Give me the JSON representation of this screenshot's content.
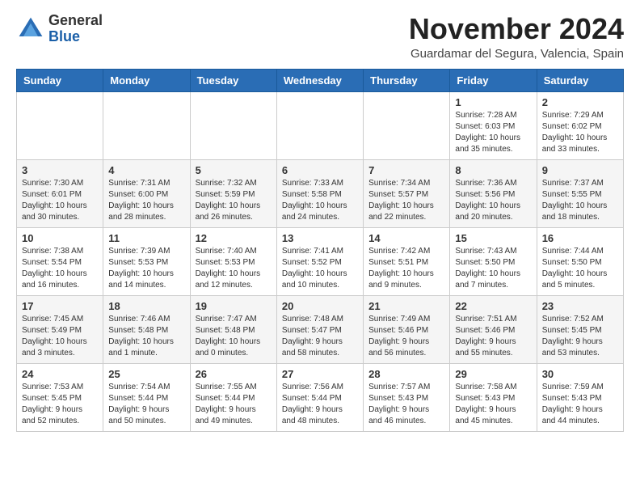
{
  "header": {
    "logo": {
      "general": "General",
      "blue": "Blue"
    },
    "title": "November 2024",
    "location": "Guardamar del Segura, Valencia, Spain"
  },
  "calendar": {
    "days_of_week": [
      "Sunday",
      "Monday",
      "Tuesday",
      "Wednesday",
      "Thursday",
      "Friday",
      "Saturday"
    ],
    "weeks": [
      [
        {
          "day": "",
          "info": ""
        },
        {
          "day": "",
          "info": ""
        },
        {
          "day": "",
          "info": ""
        },
        {
          "day": "",
          "info": ""
        },
        {
          "day": "",
          "info": ""
        },
        {
          "day": "1",
          "info": "Sunrise: 7:28 AM\nSunset: 6:03 PM\nDaylight: 10 hours and 35 minutes."
        },
        {
          "day": "2",
          "info": "Sunrise: 7:29 AM\nSunset: 6:02 PM\nDaylight: 10 hours and 33 minutes."
        }
      ],
      [
        {
          "day": "3",
          "info": "Sunrise: 7:30 AM\nSunset: 6:01 PM\nDaylight: 10 hours and 30 minutes."
        },
        {
          "day": "4",
          "info": "Sunrise: 7:31 AM\nSunset: 6:00 PM\nDaylight: 10 hours and 28 minutes."
        },
        {
          "day": "5",
          "info": "Sunrise: 7:32 AM\nSunset: 5:59 PM\nDaylight: 10 hours and 26 minutes."
        },
        {
          "day": "6",
          "info": "Sunrise: 7:33 AM\nSunset: 5:58 PM\nDaylight: 10 hours and 24 minutes."
        },
        {
          "day": "7",
          "info": "Sunrise: 7:34 AM\nSunset: 5:57 PM\nDaylight: 10 hours and 22 minutes."
        },
        {
          "day": "8",
          "info": "Sunrise: 7:36 AM\nSunset: 5:56 PM\nDaylight: 10 hours and 20 minutes."
        },
        {
          "day": "9",
          "info": "Sunrise: 7:37 AM\nSunset: 5:55 PM\nDaylight: 10 hours and 18 minutes."
        }
      ],
      [
        {
          "day": "10",
          "info": "Sunrise: 7:38 AM\nSunset: 5:54 PM\nDaylight: 10 hours and 16 minutes."
        },
        {
          "day": "11",
          "info": "Sunrise: 7:39 AM\nSunset: 5:53 PM\nDaylight: 10 hours and 14 minutes."
        },
        {
          "day": "12",
          "info": "Sunrise: 7:40 AM\nSunset: 5:53 PM\nDaylight: 10 hours and 12 minutes."
        },
        {
          "day": "13",
          "info": "Sunrise: 7:41 AM\nSunset: 5:52 PM\nDaylight: 10 hours and 10 minutes."
        },
        {
          "day": "14",
          "info": "Sunrise: 7:42 AM\nSunset: 5:51 PM\nDaylight: 10 hours and 9 minutes."
        },
        {
          "day": "15",
          "info": "Sunrise: 7:43 AM\nSunset: 5:50 PM\nDaylight: 10 hours and 7 minutes."
        },
        {
          "day": "16",
          "info": "Sunrise: 7:44 AM\nSunset: 5:50 PM\nDaylight: 10 hours and 5 minutes."
        }
      ],
      [
        {
          "day": "17",
          "info": "Sunrise: 7:45 AM\nSunset: 5:49 PM\nDaylight: 10 hours and 3 minutes."
        },
        {
          "day": "18",
          "info": "Sunrise: 7:46 AM\nSunset: 5:48 PM\nDaylight: 10 hours and 1 minute."
        },
        {
          "day": "19",
          "info": "Sunrise: 7:47 AM\nSunset: 5:48 PM\nDaylight: 10 hours and 0 minutes."
        },
        {
          "day": "20",
          "info": "Sunrise: 7:48 AM\nSunset: 5:47 PM\nDaylight: 9 hours and 58 minutes."
        },
        {
          "day": "21",
          "info": "Sunrise: 7:49 AM\nSunset: 5:46 PM\nDaylight: 9 hours and 56 minutes."
        },
        {
          "day": "22",
          "info": "Sunrise: 7:51 AM\nSunset: 5:46 PM\nDaylight: 9 hours and 55 minutes."
        },
        {
          "day": "23",
          "info": "Sunrise: 7:52 AM\nSunset: 5:45 PM\nDaylight: 9 hours and 53 minutes."
        }
      ],
      [
        {
          "day": "24",
          "info": "Sunrise: 7:53 AM\nSunset: 5:45 PM\nDaylight: 9 hours and 52 minutes."
        },
        {
          "day": "25",
          "info": "Sunrise: 7:54 AM\nSunset: 5:44 PM\nDaylight: 9 hours and 50 minutes."
        },
        {
          "day": "26",
          "info": "Sunrise: 7:55 AM\nSunset: 5:44 PM\nDaylight: 9 hours and 49 minutes."
        },
        {
          "day": "27",
          "info": "Sunrise: 7:56 AM\nSunset: 5:44 PM\nDaylight: 9 hours and 48 minutes."
        },
        {
          "day": "28",
          "info": "Sunrise: 7:57 AM\nSunset: 5:43 PM\nDaylight: 9 hours and 46 minutes."
        },
        {
          "day": "29",
          "info": "Sunrise: 7:58 AM\nSunset: 5:43 PM\nDaylight: 9 hours and 45 minutes."
        },
        {
          "day": "30",
          "info": "Sunrise: 7:59 AM\nSunset: 5:43 PM\nDaylight: 9 hours and 44 minutes."
        }
      ]
    ]
  }
}
